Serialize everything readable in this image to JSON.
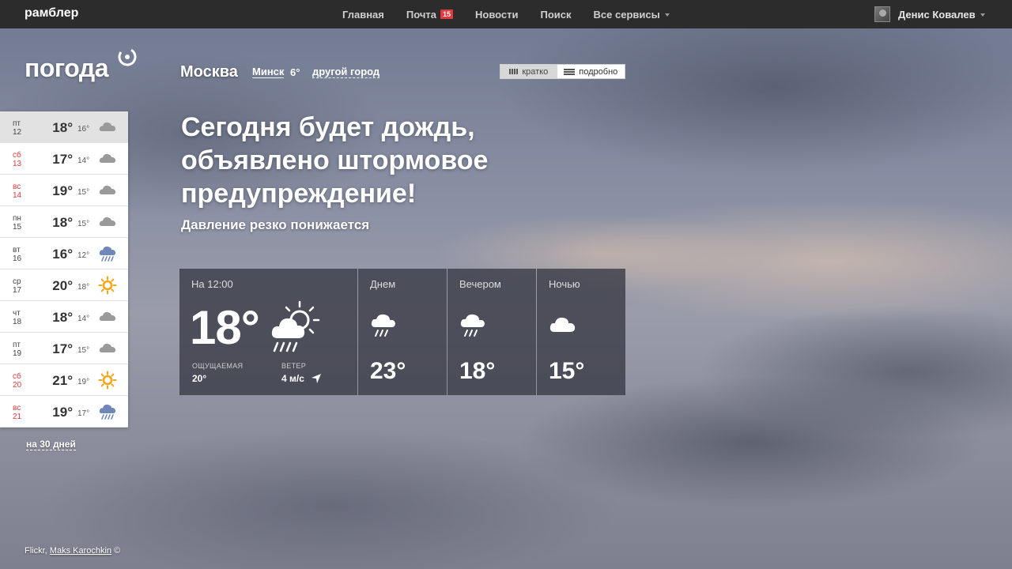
{
  "topbar": {
    "logo": "рамблер",
    "nav": [
      {
        "label": "Главная"
      },
      {
        "label": "Почта",
        "badge": "15"
      },
      {
        "label": "Новости"
      },
      {
        "label": "Поиск"
      },
      {
        "label": "Все сервисы"
      }
    ],
    "user_name": "Денис Ковалев"
  },
  "brand": "погода",
  "city": {
    "current": "Москва",
    "alt_name": "Минск",
    "alt_temp": "6°",
    "other_link": "другой город"
  },
  "view_toggle": {
    "short": "кратко",
    "detailed": "подробно",
    "active": "short"
  },
  "headline": "Сегодня будет дождь, объявлено штормовое предупреждение!",
  "subline": "Давление резко понижается",
  "days": [
    {
      "dow": "пт",
      "day": "12",
      "hi": "18°",
      "lo": "16°",
      "icon": "cloud-icon",
      "weekend": false,
      "active": true
    },
    {
      "dow": "сб",
      "day": "13",
      "hi": "17°",
      "lo": "14°",
      "icon": "cloud-icon",
      "weekend": true,
      "active": false
    },
    {
      "dow": "вс",
      "day": "14",
      "hi": "19°",
      "lo": "15°",
      "icon": "cloud-icon",
      "weekend": true,
      "active": false
    },
    {
      "dow": "пн",
      "day": "15",
      "hi": "18°",
      "lo": "15°",
      "icon": "cloud-icon",
      "weekend": false,
      "active": false
    },
    {
      "dow": "вт",
      "day": "16",
      "hi": "16°",
      "lo": "12°",
      "icon": "rain-icon",
      "weekend": false,
      "active": false
    },
    {
      "dow": "ср",
      "day": "17",
      "hi": "20°",
      "lo": "18°",
      "icon": "sun-icon",
      "weekend": false,
      "active": false
    },
    {
      "dow": "чт",
      "day": "18",
      "hi": "18°",
      "lo": "14°",
      "icon": "cloud-icon",
      "weekend": false,
      "active": false
    },
    {
      "dow": "пт",
      "day": "19",
      "hi": "17°",
      "lo": "15°",
      "icon": "cloud-icon",
      "weekend": false,
      "active": false
    },
    {
      "dow": "сб",
      "day": "20",
      "hi": "21°",
      "lo": "19°",
      "icon": "sun-icon",
      "weekend": true,
      "active": false
    },
    {
      "dow": "вс",
      "day": "21",
      "hi": "19°",
      "lo": "17°",
      "icon": "rain-icon",
      "weekend": true,
      "active": false
    }
  ],
  "month_link": "на 30 дней",
  "now": {
    "label": "На 12:00",
    "temp": "18°",
    "icon": "sun-cloud-rain-icon",
    "feels_label": "ОЩУЩАЕМАЯ",
    "feels_value": "20°",
    "wind_label": "ВЕТЕР",
    "wind_value": "4 м/с"
  },
  "parts": [
    {
      "label": "Днем",
      "temp": "23°",
      "icon": "rain-icon"
    },
    {
      "label": "Вечером",
      "temp": "18°",
      "icon": "rain-icon"
    },
    {
      "label": "Ночью",
      "temp": "15°",
      "icon": "cloud-icon"
    }
  ],
  "credit": {
    "source": "Flickr,",
    "author": "Maks Karochkin",
    "copy": "©"
  },
  "colors": {
    "topbar": "#2c2c2c",
    "weekend": "#e3393c",
    "badge": "#e3393c",
    "sun": "#f2a515",
    "rain_cloud": "#6f86b8"
  }
}
